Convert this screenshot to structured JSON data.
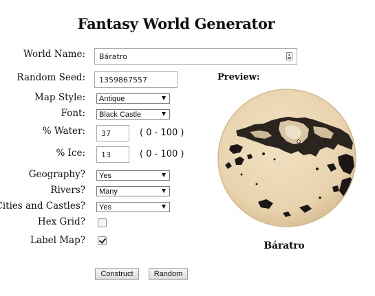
{
  "page": {
    "title": "Fantasy World Generator"
  },
  "form": {
    "world_name": {
      "label": "World Name:",
      "value": "Báratro"
    },
    "random_seed": {
      "label": "Random Seed:",
      "value": "1359867557"
    },
    "map_style": {
      "label": "Map Style:",
      "selected": "Antique"
    },
    "font": {
      "label": "Font:",
      "selected": "Black Castle"
    },
    "water": {
      "label": "% Water:",
      "value": "37",
      "range": "( 0 - 100 )"
    },
    "ice": {
      "label": "% Ice:",
      "value": "13",
      "range": "( 0 - 100 )"
    },
    "geography": {
      "label": "Geography?",
      "selected": "Yes"
    },
    "rivers": {
      "label": "Rivers?",
      "selected": "Many"
    },
    "cities": {
      "label": "Cities and Castles?",
      "selected": "Yes"
    },
    "hex_grid": {
      "label": "Hex Grid?",
      "checked": false
    },
    "label_map": {
      "label": "Label Map?",
      "checked": true
    }
  },
  "buttons": {
    "construct": "Construct",
    "random": "Random"
  },
  "preview": {
    "label": "Preview:",
    "map_label": "Báratro",
    "colors": {
      "ocean": "#ecd9b6",
      "ocean_edge": "#d7bf96",
      "land": "#161310"
    }
  },
  "icons": {
    "contacts_autofill": "contact-card-icon"
  }
}
